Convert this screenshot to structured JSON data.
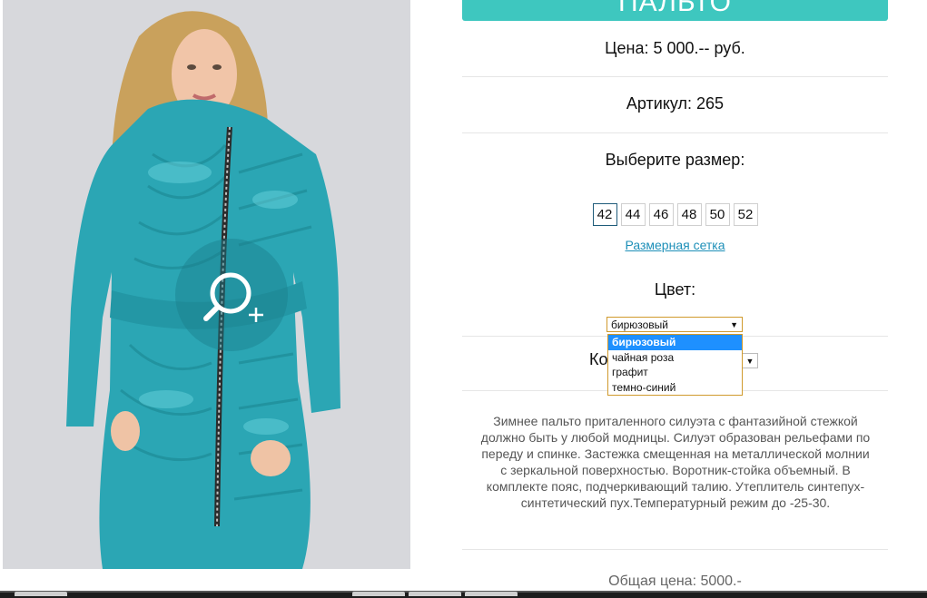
{
  "product": {
    "title": "ПАЛЬТО",
    "price_text": "Цена: 5 000.-- руб.",
    "article_text": "Артикул: 265",
    "size_title": "Выберите размер:",
    "sizes": [
      "42",
      "44",
      "46",
      "48",
      "50",
      "52"
    ],
    "selected_size": "42",
    "size_chart_link": "Размерная сетка",
    "color_title": "Цвет:",
    "color_select": {
      "value": "бирюзовый",
      "options": [
        "бирюзовый",
        "чайная роза",
        "графит",
        "темно-синий"
      ],
      "highlighted": "бирюзовый"
    },
    "quantity_label": "Ко",
    "description": "Зимнее пальто приталенного силуэта с фантазийной стежкой должно быть у любой модницы. Силуэт образован рельефами по переду и спинке. Застежка смещенная на металлической молнии с зеркальной поверхностью. Воротник-стойка объемный. В комплекте пояс, подчеркивающий талию. Утеплитель синтепух-синтетический пух.Температурный режим до -25-30.",
    "total_text": "Общая цена: 5000.-"
  },
  "icons": {
    "zoom": "zoom-in-icon",
    "dropdown_arrow": "triangle-down-icon"
  },
  "colors": {
    "accent": "#3ec7bf",
    "link": "#1d8fb8",
    "highlight": "#1e90ff",
    "coat": "#2ba6b4"
  }
}
